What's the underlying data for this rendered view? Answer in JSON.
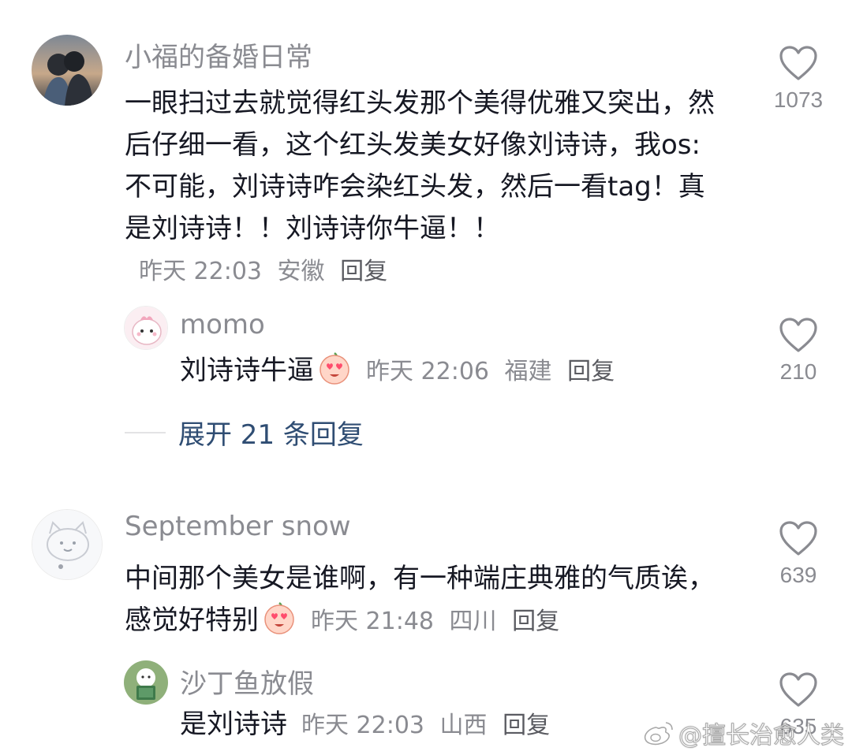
{
  "comments": [
    {
      "username": "小福的备婚日常",
      "text": "一眼扫过去就觉得红头发那个美得优雅又突出，然后仔细一看，这个红头发美女好像刘诗诗，我os:不可能，刘诗诗咋会染红头发，然后一看tag！真是刘诗诗！！刘诗诗你牛逼！！",
      "time": "昨天 22:03",
      "location": "安徽",
      "reply_label": "回复",
      "likes": "1073",
      "replies": [
        {
          "username": "momo",
          "text": "刘诗诗牛逼",
          "emoji": "heart-eyes-emoji",
          "time": "昨天 22:06",
          "location": "福建",
          "reply_label": "回复",
          "likes": "210"
        }
      ],
      "expand_label": "展开 21 条回复"
    },
    {
      "username": "September snow",
      "text": "中间那个美女是谁啊，有一种端庄典雅的气质诶，感觉好特别",
      "emoji": "heart-eyes-emoji",
      "time": "昨天 21:48",
      "location": "四川",
      "reply_label": "回复",
      "likes": "639",
      "replies": [
        {
          "username": "沙丁鱼放假",
          "text": "是刘诗诗",
          "time": "昨天 22:03",
          "location": "山西",
          "reply_label": "回复",
          "likes": "635"
        }
      ]
    }
  ],
  "watermark": "@擅长治愈人类",
  "colors": {
    "username": "#8a8b91",
    "text": "#161823",
    "meta": "#8a8b91",
    "expand": "#2f4d73",
    "heart": "#8a8b91"
  },
  "icons": {
    "like": "heart-outline-icon",
    "watermark": "weibo-logo-icon"
  }
}
